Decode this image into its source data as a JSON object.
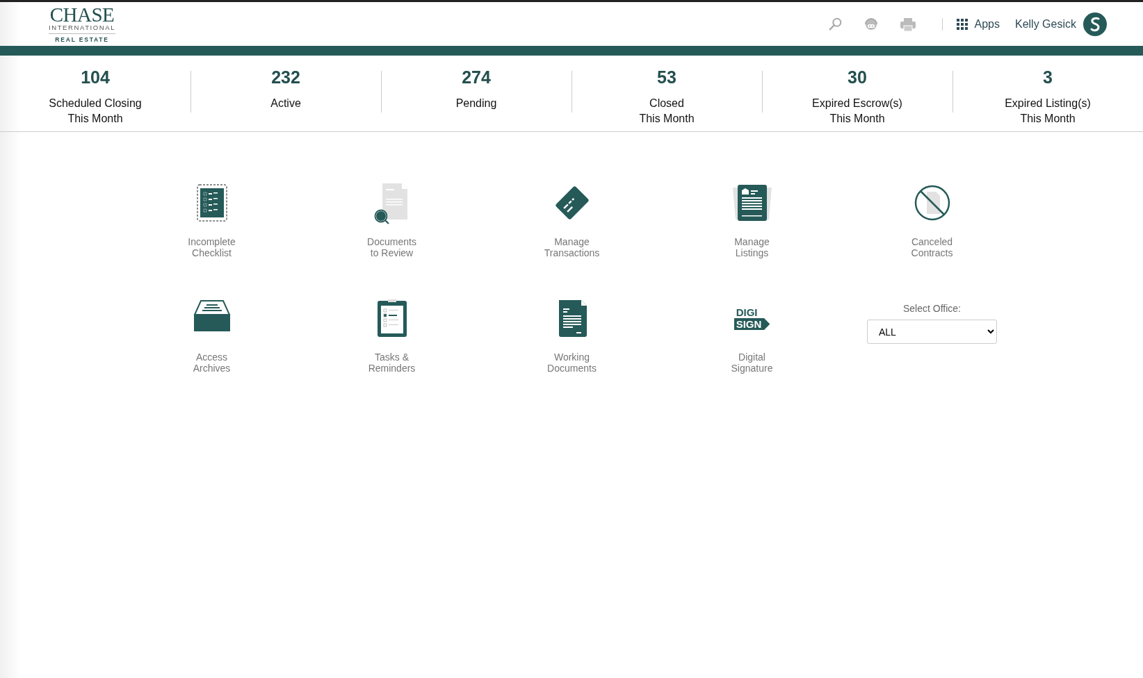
{
  "header": {
    "logo": {
      "name": "CHASE",
      "line_1": "INTERNATIONAL",
      "line_2": "REAL ESTATE"
    },
    "apps_label": "Apps",
    "user_name": "Kelly Gesick"
  },
  "stats": [
    {
      "value": "104",
      "label_lines": [
        "Scheduled Closing",
        "This Month"
      ]
    },
    {
      "value": "232",
      "label_lines": [
        "Active"
      ]
    },
    {
      "value": "274",
      "label_lines": [
        "Pending"
      ]
    },
    {
      "value": "53",
      "label_lines": [
        "Closed",
        "This Month"
      ]
    },
    {
      "value": "30",
      "label_lines": [
        "Expired Escrow(s)",
        "This Month"
      ]
    },
    {
      "value": "3",
      "label_lines": [
        "Expired Listing(s)",
        "This Month"
      ]
    }
  ],
  "tiles": [
    {
      "label_lines": [
        "Incomplete",
        "Checklist"
      ]
    },
    {
      "label_lines": [
        "Documents",
        "to Review"
      ]
    },
    {
      "label_lines": [
        "Manage",
        "Transactions"
      ]
    },
    {
      "label_lines": [
        "Manage",
        "Listings"
      ]
    },
    {
      "label_lines": [
        "Canceled",
        "Contracts"
      ]
    },
    {
      "label_lines": [
        "Access",
        "Archives"
      ]
    },
    {
      "label_lines": [
        "Tasks &",
        "Reminders"
      ]
    },
    {
      "label_lines": [
        "Working",
        "Documents"
      ]
    },
    {
      "label_lines": [
        "Digital",
        "Signature"
      ],
      "icon_text": [
        "DIGI",
        "SIGN"
      ]
    }
  ],
  "office_select": {
    "label": "Select Office:",
    "value": "ALL"
  }
}
